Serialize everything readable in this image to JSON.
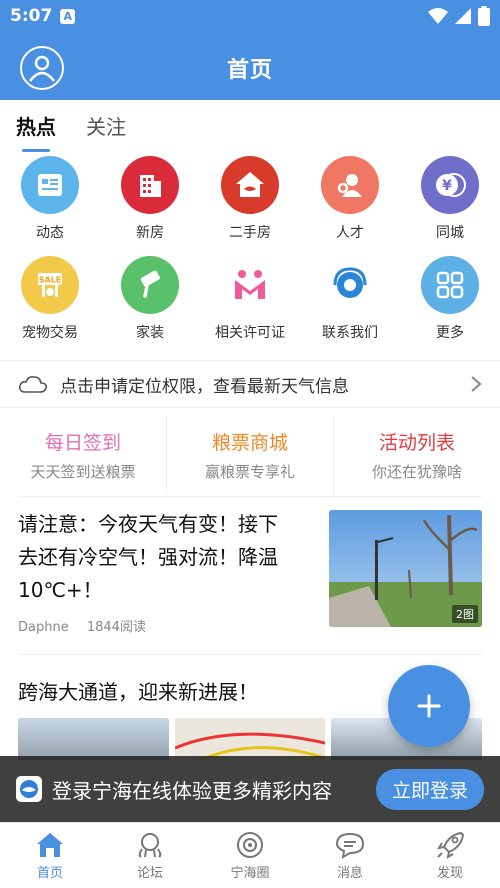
{
  "status_bar": {
    "time": "5:07",
    "notif_letter": "A"
  },
  "header": {
    "title": "首页"
  },
  "tabs": [
    {
      "label": "热点",
      "active": true
    },
    {
      "label": "关注",
      "active": false
    }
  ],
  "grid": [
    {
      "label": "动态",
      "icon": "news-icon",
      "color": "#5bb5ea"
    },
    {
      "label": "新房",
      "icon": "building-icon",
      "color": "#d92b3a"
    },
    {
      "label": "二手房",
      "icon": "house-handshake-icon",
      "color": "#d83a2c"
    },
    {
      "label": "人才",
      "icon": "person-icon",
      "color": "#f07763"
    },
    {
      "label": "同城",
      "icon": "yen-coin-icon",
      "color": "#6f6fc9"
    },
    {
      "label": "宠物交易",
      "icon": "sale-sign-icon",
      "color": "#f3c94a"
    },
    {
      "label": "家装",
      "icon": "paint-roller-icon",
      "color": "#58c169"
    },
    {
      "label": "相关许可证",
      "icon": "m-letter-icon",
      "color": "#f05a9a"
    },
    {
      "label": "联系我们",
      "icon": "headset-icon",
      "color": "#2a86d8"
    },
    {
      "label": "更多",
      "icon": "grid-more-icon",
      "color": "#5cb0e6"
    }
  ],
  "weather": {
    "text": "点击申请定位权限，查看最新天气信息"
  },
  "promo": [
    {
      "title": "每日签到",
      "sub": "天天签到送粮票",
      "color": "#e06fb3"
    },
    {
      "title": "粮票商城",
      "sub": "赢粮票专享礼",
      "color": "#ec8a2b"
    },
    {
      "title": "活动列表",
      "sub": "你还在犹豫啥",
      "color": "#e23c3c"
    }
  ],
  "article1": {
    "title_line1": "请注意：今夜天气有变！接下",
    "title_line2": "去还有冷空气！强对流！降温",
    "title_line3": "10℃+！",
    "author": "Daphne",
    "reads": "1844阅读",
    "image_count": "2图"
  },
  "article2": {
    "title": "跨海大通道，迎来新进展！"
  },
  "login_bar": {
    "text": "登录宁海在线体验更多精彩内容",
    "button": "立即登录"
  },
  "bottom_nav": [
    {
      "label": "首页",
      "icon": "home-icon",
      "active": true
    },
    {
      "label": "论坛",
      "icon": "forum-icon",
      "active": false
    },
    {
      "label": "宁海圈",
      "icon": "camera-circle-icon",
      "active": false
    },
    {
      "label": "消息",
      "icon": "chat-icon",
      "active": false
    },
    {
      "label": "发现",
      "icon": "rocket-icon",
      "active": false
    }
  ],
  "colors": {
    "primary": "#4a90e2"
  }
}
